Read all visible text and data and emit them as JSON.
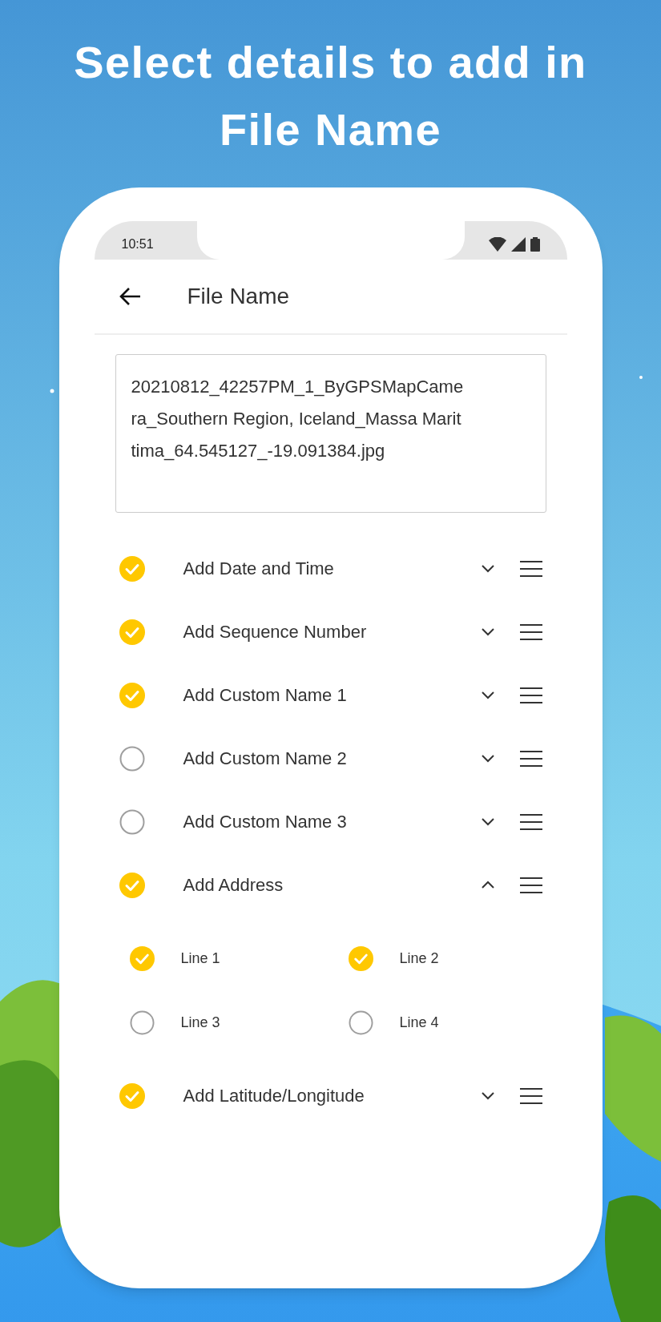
{
  "headline": "Select details to add in File Name",
  "status_bar": {
    "time": "10:51"
  },
  "header": {
    "title": "File Name"
  },
  "file_name": {
    "value": "20210812_42257PM_1_ByGPSMapCamera_Southern Region, Iceland_Massa Marittima_64.545127_-19.091384.jpg"
  },
  "options": [
    {
      "label": "Add Date and Time",
      "checked": true,
      "expanded": false
    },
    {
      "label": "Add Sequence Number",
      "checked": true,
      "expanded": false
    },
    {
      "label": "Add Custom Name 1",
      "checked": true,
      "expanded": false
    },
    {
      "label": "Add Custom Name 2",
      "checked": false,
      "expanded": false
    },
    {
      "label": "Add Custom Name 3",
      "checked": false,
      "expanded": false
    },
    {
      "label": "Add Address",
      "checked": true,
      "expanded": true,
      "children": [
        {
          "label": "Line 1",
          "checked": true
        },
        {
          "label": "Line 2",
          "checked": true
        },
        {
          "label": "Line 3",
          "checked": false
        },
        {
          "label": "Line 4",
          "checked": false
        }
      ]
    },
    {
      "label": "Add Latitude/Longitude",
      "checked": true,
      "expanded": false
    }
  ]
}
